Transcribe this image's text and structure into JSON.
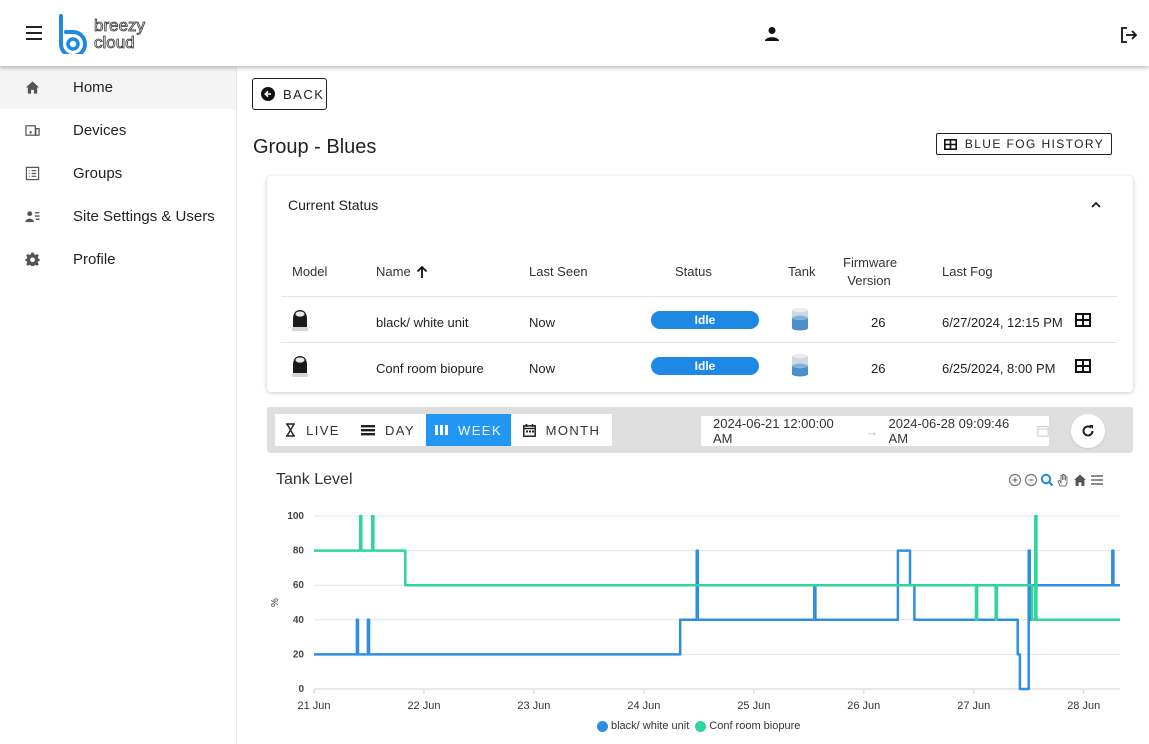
{
  "logo": {
    "line1": "breezy",
    "line2": "cloud"
  },
  "sidebar": {
    "items": [
      {
        "label": "Home",
        "icon": "home-icon"
      },
      {
        "label": "Devices",
        "icon": "devices-icon"
      },
      {
        "label": "Groups",
        "icon": "groups-icon"
      },
      {
        "label": "Site Settings & Users",
        "icon": "site-settings-icon"
      },
      {
        "label": "Profile",
        "icon": "gear-icon"
      }
    ]
  },
  "header": {
    "back_label": "BACK",
    "page_title": "Group - Blues",
    "history_label": "BLUE FOG HISTORY"
  },
  "status_card": {
    "title": "Current Status",
    "columns": {
      "model": "Model",
      "name": "Name",
      "last_seen": "Last Seen",
      "status": "Status",
      "tank": "Tank",
      "firmware_line1": "Firmware",
      "firmware_line2": "Version",
      "last_fog": "Last Fog"
    },
    "rows": [
      {
        "name": "black/ white unit",
        "last_seen": "Now",
        "status": "Idle",
        "firmware": "26",
        "last_fog": "6/27/2024, 12:15 PM"
      },
      {
        "name": "Conf room biopure",
        "last_seen": "Now",
        "status": "Idle",
        "firmware": "26",
        "last_fog": "6/25/2024, 8:00 PM"
      }
    ]
  },
  "range": {
    "segments": [
      "LIVE",
      "DAY",
      "WEEK",
      "MONTH"
    ],
    "active": "WEEK",
    "start": "2024-06-21 12:00:00 AM",
    "arrow": "→",
    "end": "2024-06-28 09:09:46 AM"
  },
  "colors": {
    "accent": "#2196f3",
    "series1": "#2e8fe0",
    "series2": "#2ed69a"
  },
  "chart_data": {
    "type": "line",
    "title": "Tank Level",
    "ylabel": "%",
    "ylim": [
      0,
      100
    ],
    "yticks": [
      0,
      20,
      40,
      60,
      80,
      100
    ],
    "xlim": [
      21.0,
      28.33
    ],
    "xticks": [
      21,
      22,
      23,
      24,
      25,
      26,
      27,
      28
    ],
    "xtick_labels": [
      "21 Jun",
      "22 Jun",
      "23 Jun",
      "24 Jun",
      "25 Jun",
      "26 Jun",
      "27 Jun",
      "28 Jun"
    ],
    "grid": true,
    "legend_position": "bottom",
    "series": [
      {
        "name": "black/ white unit",
        "color": "#2e8fe0",
        "points": [
          [
            21.0,
            20
          ],
          [
            21.39,
            20
          ],
          [
            21.39,
            40
          ],
          [
            21.4,
            40
          ],
          [
            21.4,
            20
          ],
          [
            21.49,
            20
          ],
          [
            21.49,
            40
          ],
          [
            21.5,
            40
          ],
          [
            21.5,
            20
          ],
          [
            24.33,
            20
          ],
          [
            24.33,
            40
          ],
          [
            24.48,
            40
          ],
          [
            24.48,
            80
          ],
          [
            24.49,
            80
          ],
          [
            24.49,
            40
          ],
          [
            25.55,
            40
          ],
          [
            25.55,
            60
          ],
          [
            25.56,
            60
          ],
          [
            25.56,
            40
          ],
          [
            26.31,
            40
          ],
          [
            26.31,
            80
          ],
          [
            26.42,
            80
          ],
          [
            26.42,
            60
          ],
          [
            26.46,
            60
          ],
          [
            26.46,
            40
          ],
          [
            27.4,
            40
          ],
          [
            27.4,
            20
          ],
          [
            27.42,
            20
          ],
          [
            27.42,
            0
          ],
          [
            27.5,
            0
          ],
          [
            27.5,
            80
          ],
          [
            27.51,
            80
          ],
          [
            27.51,
            40
          ],
          [
            27.53,
            40
          ],
          [
            27.53,
            60
          ],
          [
            28.26,
            60
          ],
          [
            28.26,
            80
          ],
          [
            28.27,
            80
          ],
          [
            28.27,
            60
          ],
          [
            28.33,
            60
          ]
        ]
      },
      {
        "name": "Conf room biopure",
        "color": "#2ed69a",
        "points": [
          [
            21.0,
            80
          ],
          [
            21.42,
            80
          ],
          [
            21.42,
            100
          ],
          [
            21.43,
            100
          ],
          [
            21.43,
            80
          ],
          [
            21.53,
            80
          ],
          [
            21.53,
            100
          ],
          [
            21.54,
            100
          ],
          [
            21.54,
            80
          ],
          [
            21.83,
            80
          ],
          [
            21.83,
            60
          ],
          [
            27.02,
            60
          ],
          [
            27.02,
            40
          ],
          [
            27.03,
            40
          ],
          [
            27.03,
            60
          ],
          [
            27.2,
            60
          ],
          [
            27.2,
            40
          ],
          [
            27.21,
            40
          ],
          [
            27.21,
            60
          ],
          [
            27.53,
            60
          ],
          [
            27.53,
            40
          ],
          [
            27.56,
            40
          ],
          [
            27.56,
            100
          ],
          [
            27.57,
            100
          ],
          [
            27.57,
            40
          ],
          [
            28.33,
            40
          ]
        ]
      }
    ]
  }
}
